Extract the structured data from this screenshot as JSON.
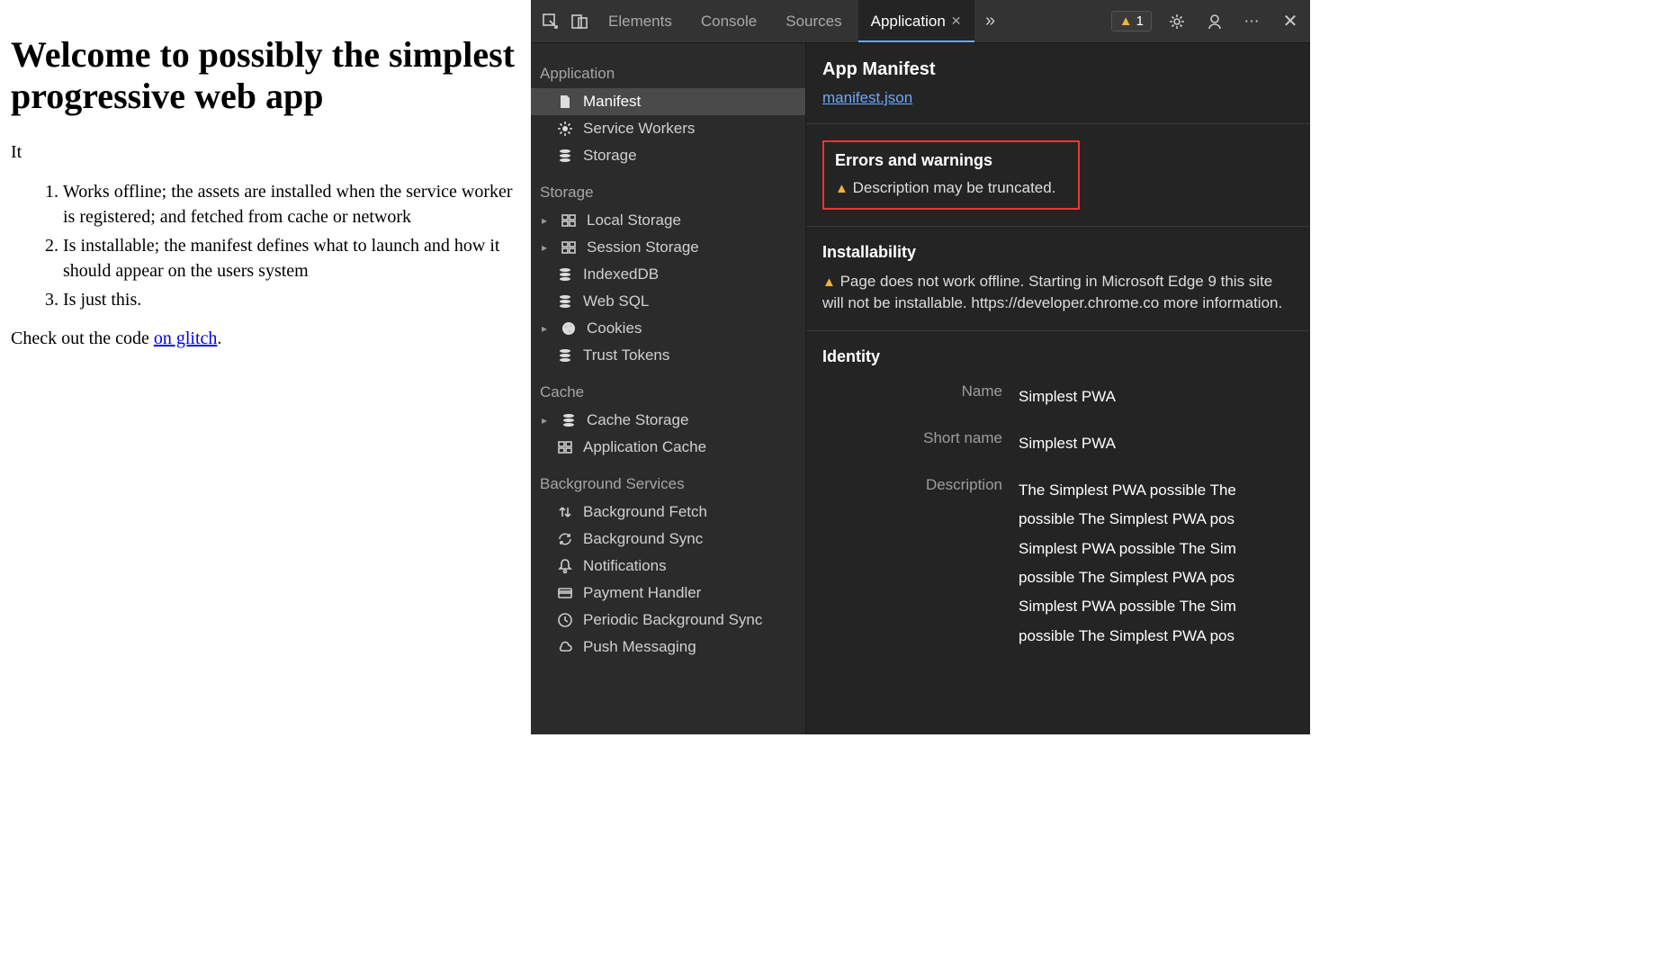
{
  "page": {
    "heading": "Welcome to possibly the simplest progressive web app",
    "intro": "It",
    "items": [
      "Works offline; the assets are installed when the service worker is registered; and fetched from cache or network",
      "Is installable; the manifest defines what to launch and how it should appear on the users system",
      "Is just this."
    ],
    "checkout_prefix": "Check out the code ",
    "checkout_link": "on glitch",
    "checkout_suffix": "."
  },
  "devtools": {
    "tabs": [
      "Elements",
      "Console",
      "Sources",
      "Application"
    ],
    "active_tab": "Application",
    "warnings_badge": "1",
    "sidebar": {
      "groups": [
        {
          "label": "Application",
          "items": [
            {
              "icon": "file-icon",
              "label": "Manifest",
              "selected": true
            },
            {
              "icon": "gear-icon",
              "label": "Service Workers"
            },
            {
              "icon": "db-icon",
              "label": "Storage"
            }
          ]
        },
        {
          "label": "Storage",
          "items": [
            {
              "icon": "grid-icon",
              "label": "Local Storage",
              "expandable": true
            },
            {
              "icon": "grid-icon",
              "label": "Session Storage",
              "expandable": true
            },
            {
              "icon": "db-icon",
              "label": "IndexedDB"
            },
            {
              "icon": "db-icon",
              "label": "Web SQL"
            },
            {
              "icon": "cookie-icon",
              "label": "Cookies",
              "expandable": true
            },
            {
              "icon": "db-icon",
              "label": "Trust Tokens"
            }
          ]
        },
        {
          "label": "Cache",
          "items": [
            {
              "icon": "db-icon",
              "label": "Cache Storage",
              "expandable": true
            },
            {
              "icon": "grid-icon",
              "label": "Application Cache"
            }
          ]
        },
        {
          "label": "Background Services",
          "items": [
            {
              "icon": "updown-icon",
              "label": "Background Fetch"
            },
            {
              "icon": "sync-icon",
              "label": "Background Sync"
            },
            {
              "icon": "bell-icon",
              "label": "Notifications"
            },
            {
              "icon": "card-icon",
              "label": "Payment Handler"
            },
            {
              "icon": "clock-icon",
              "label": "Periodic Background Sync"
            },
            {
              "icon": "cloud-icon",
              "label": "Push Messaging"
            }
          ]
        }
      ]
    },
    "main": {
      "title": "App Manifest",
      "manifest_link": "manifest.json",
      "errors_heading": "Errors and warnings",
      "errors_item": "Description may be truncated.",
      "install_heading": "Installability",
      "install_msg": "Page does not work offline. Starting in Microsoft Edge 9 this site will not be installable. https://developer.chrome.co more information.",
      "identity_heading": "Identity",
      "identity": {
        "name_label": "Name",
        "name_val": "Simplest PWA",
        "short_label": "Short name",
        "short_val": "Simplest PWA",
        "desc_label": "Description",
        "desc_val": "The Simplest PWA possible The possible The Simplest PWA pos Simplest PWA possible The Sim possible The Simplest PWA pos Simplest PWA possible The Sim possible The Simplest PWA pos"
      }
    }
  }
}
